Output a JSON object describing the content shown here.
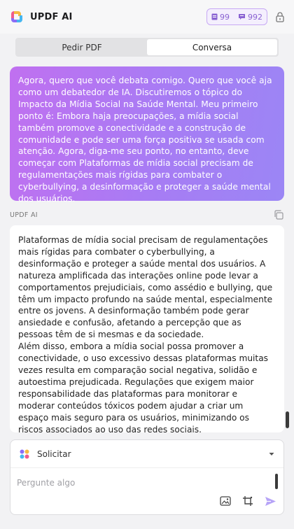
{
  "header": {
    "app_title": "UPDF AI",
    "quota_docs": "99",
    "quota_messages": "992"
  },
  "tabs": [
    {
      "label": "Pedir PDF",
      "active": false
    },
    {
      "label": "Conversa",
      "active": true
    }
  ],
  "user_message": "Agora, quero que você debata comigo. Quero que você aja como um debatedor de IA. Discutiremos o tópico do Impacto da Mídia Social na Saúde Mental. Meu primeiro ponto é: Embora haja preocupações, a mídia social também promove a conectividade e a construção de comunidade e pode ser uma força positiva se usada com atenção. Agora, diga-me seu ponto, no entanto, deve começar com Plataformas de mídia social precisam de regulamentações mais rígidas para combater o cyberbullying, a desinformação e proteger a saúde mental dos usuários.",
  "ai_label": "UPDF AI",
  "ai_response": {
    "paragraphs": [
      "Plataformas de mídia social precisam de regulamentações mais rígidas para combater o cyberbullying, a desinformação e proteger a saúde mental dos usuários. A natureza amplificada das interações online pode levar a comportamentos prejudiciais, como assédio e bullying, que têm um impacto profundo na saúde mental, especialmente entre os jovens. A desinformação também pode gerar ansiedade e confusão, afetando a percepção que as pessoas têm de si mesmas e da sociedade.",
      "Além disso, embora a mídia social possa promover a conectividade, o uso excessivo dessas plataformas muitas vezes resulta em comparação social negativa, solidão e autoestima prejudicada. Regulações que exigem maior responsabilidade das plataformas para monitorar e moderar conteúdos tóxicos podem ajudar a criar um espaço mais seguro para os usuários, minimizando os riscos associados ao uso das redes sociais."
    ]
  },
  "composer": {
    "mode_label": "Solicitar",
    "placeholder": "Pergunte algo"
  },
  "colors": {
    "accent": "#a77cf4",
    "send": "#b6a3f7"
  },
  "icons": [
    "updf-logo-icon",
    "document-icon",
    "message-icon",
    "lock-icon",
    "copy-icon",
    "colored-dots-icon",
    "chevron-down-icon",
    "image-icon",
    "crop-icon",
    "send-icon"
  ]
}
